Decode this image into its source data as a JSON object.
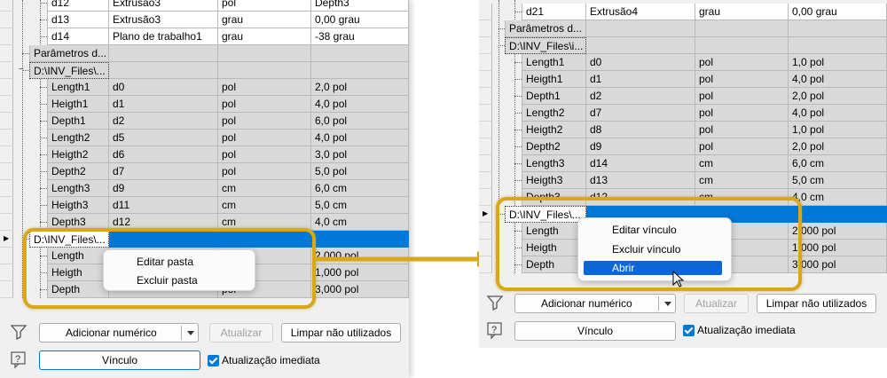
{
  "left": {
    "rows": [
      {
        "name": "d12",
        "eq": "Extrusão3",
        "unit": "pol",
        "val": "Depth3",
        "style": "white"
      },
      {
        "name": "d13",
        "eq": "Extrusão3",
        "unit": "grau",
        "val": "0,00 grau",
        "style": "white"
      },
      {
        "name": "d14",
        "eq": "Plano de trabalho1",
        "unit": "grau",
        "val": "-38 grau",
        "style": "white"
      },
      {
        "name": "Parâmetros d...",
        "eq": "",
        "unit": "",
        "val": "",
        "style": "group"
      },
      {
        "name": "D:\\INV_Files\\...",
        "eq": "",
        "unit": "",
        "val": "",
        "style": "group"
      },
      {
        "name": "Length1",
        "eq": "d0",
        "unit": "pol",
        "val": "2,0 pol",
        "style": "gray"
      },
      {
        "name": "Heigth1",
        "eq": "d1",
        "unit": "pol",
        "val": "4,0 pol",
        "style": "gray"
      },
      {
        "name": "Depth1",
        "eq": "d2",
        "unit": "pol",
        "val": "6,0 pol",
        "style": "gray"
      },
      {
        "name": "Length2",
        "eq": "d5",
        "unit": "pol",
        "val": "4,0 pol",
        "style": "gray"
      },
      {
        "name": "Heigth2",
        "eq": "d6",
        "unit": "pol",
        "val": "3,0 pol",
        "style": "gray"
      },
      {
        "name": "Depth2",
        "eq": "d7",
        "unit": "pol",
        "val": "5,0 pol",
        "style": "gray"
      },
      {
        "name": "Length3",
        "eq": "d9",
        "unit": "cm",
        "val": "6,0 cm",
        "style": "gray"
      },
      {
        "name": "Heigth3",
        "eq": "d11",
        "unit": "cm",
        "val": "5,0 cm",
        "style": "gray"
      },
      {
        "name": "Depth3",
        "eq": "d12",
        "unit": "cm",
        "val": "4,0 cm",
        "style": "gray"
      },
      {
        "name": "D:\\INV_Files\\...",
        "eq": "",
        "unit": "",
        "val": "",
        "style": "selected"
      },
      {
        "name": "Length",
        "eq": "",
        "unit": "",
        "val": "2,000 pol",
        "style": "gray"
      },
      {
        "name": "Heigth",
        "eq": "",
        "unit": "",
        "val": "1,000 pol",
        "style": "gray"
      },
      {
        "name": "Depth",
        "eq": "",
        "unit": "pol",
        "val": "3,000 pol",
        "style": "gray"
      }
    ],
    "menu": [
      "Editar pasta",
      "Excluir pasta"
    ],
    "buttons": {
      "add": "Adicionar numérico",
      "update": "Atualizar",
      "purge": "Limpar não utilizados",
      "link": "Vínculo",
      "immediate": "Atualização imediata"
    }
  },
  "right": {
    "rows": [
      {
        "name": "d21",
        "eq": "Extrusão4",
        "unit": "grau",
        "val": "0,00 grau",
        "style": "white"
      },
      {
        "name": "Parâmetros d...",
        "eq": "",
        "unit": "",
        "val": "",
        "style": "group"
      },
      {
        "name": "D:\\INV_Files\\i...",
        "eq": "",
        "unit": "",
        "val": "",
        "style": "group"
      },
      {
        "name": "Length1",
        "eq": "d0",
        "unit": "pol",
        "val": "1,0 pol",
        "style": "gray"
      },
      {
        "name": "Heigth1",
        "eq": "d1",
        "unit": "pol",
        "val": "4,0 pol",
        "style": "gray"
      },
      {
        "name": "Depth1",
        "eq": "d2",
        "unit": "pol",
        "val": "2,0 pol",
        "style": "gray"
      },
      {
        "name": "Length2",
        "eq": "d7",
        "unit": "pol",
        "val": "4,0 pol",
        "style": "gray"
      },
      {
        "name": "Heigth2",
        "eq": "d8",
        "unit": "pol",
        "val": "1,0 pol",
        "style": "gray"
      },
      {
        "name": "Depth2",
        "eq": "d9",
        "unit": "pol",
        "val": "2,0 pol",
        "style": "gray"
      },
      {
        "name": "Length3",
        "eq": "d14",
        "unit": "cm",
        "val": "6,0 cm",
        "style": "gray"
      },
      {
        "name": "Heigth3",
        "eq": "d13",
        "unit": "cm",
        "val": "5,0 cm",
        "style": "gray"
      },
      {
        "name": "Depth3",
        "eq": "d12",
        "unit": "cm",
        "val": "4,0 cm",
        "style": "gray"
      },
      {
        "name": "D:\\INV_Files\\...",
        "eq": "",
        "unit": "",
        "val": "",
        "style": "selected"
      },
      {
        "name": "Length",
        "eq": "",
        "unit": "",
        "val": "2,000 pol",
        "style": "gray"
      },
      {
        "name": "Heigth",
        "eq": "",
        "unit": "",
        "val": "1,000 pol",
        "style": "gray"
      },
      {
        "name": "Depth",
        "eq": "",
        "unit": "",
        "val": "3,000 pol",
        "style": "gray"
      }
    ],
    "menu": [
      "Editar vínculo",
      "Excluir vínculo",
      "Abrir"
    ],
    "buttons": {
      "add": "Adicionar numérico",
      "update": "Atualizar",
      "purge": "Limpar não utilizados",
      "link": "Vínculo",
      "immediate": "Atualização imediata"
    }
  },
  "colors": {
    "highlight": "#d9a71a",
    "selection": "#0078d7",
    "menu_highlight": "#0c66d4"
  }
}
